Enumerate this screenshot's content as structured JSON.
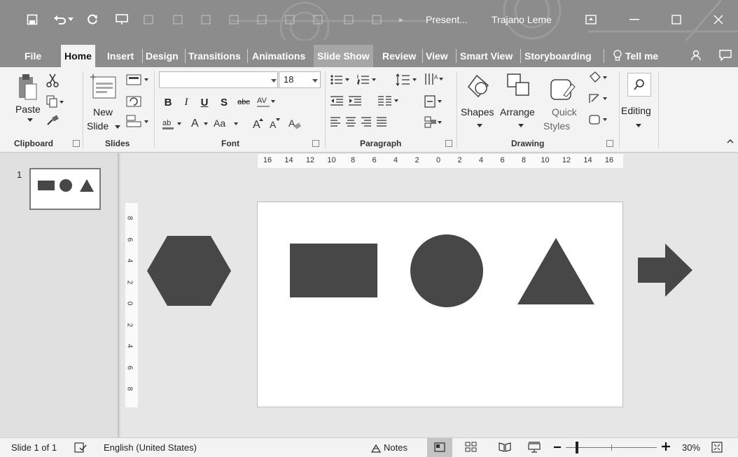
{
  "window": {
    "title": "Present...",
    "user": "Trajano Leme"
  },
  "tabs": [
    {
      "label": "File"
    },
    {
      "label": "Home"
    },
    {
      "label": "Insert"
    },
    {
      "label": "Design"
    },
    {
      "label": "Transitions"
    },
    {
      "label": "Animations"
    },
    {
      "label": "Slide Show"
    },
    {
      "label": "Review"
    },
    {
      "label": "View"
    },
    {
      "label": "Smart View"
    },
    {
      "label": "Storyboarding"
    },
    {
      "label": "Tell me"
    }
  ],
  "ribbon": {
    "clipboard": {
      "label": "Clipboard",
      "paste": "Paste"
    },
    "slides": {
      "label": "Slides",
      "new_slide_1": "New",
      "new_slide_2": "Slide"
    },
    "font": {
      "label": "Font",
      "font_name": "",
      "font_size": "18"
    },
    "paragraph": {
      "label": "Paragraph"
    },
    "drawing": {
      "label": "Drawing",
      "shapes": "Shapes",
      "arrange": "Arrange",
      "quick_1": "Quick",
      "quick_2": "Styles"
    },
    "editing": {
      "label": "Editing"
    }
  },
  "thumbnails": [
    {
      "number": "1"
    }
  ],
  "ruler": {
    "horizontal": [
      "16",
      "14",
      "12",
      "10",
      "8",
      "6",
      "4",
      "2",
      "0",
      "2",
      "4",
      "6",
      "8",
      "10",
      "12",
      "14",
      "16"
    ],
    "vertical": [
      "8",
      "6",
      "4",
      "2",
      "0",
      "2",
      "4",
      "6",
      "8"
    ]
  },
  "status": {
    "slide": "Slide 1 of 1",
    "language": "English (United States)",
    "notes": "Notes",
    "zoom": "30%"
  },
  "colors": {
    "shape_fill": "#474747",
    "titlebar": "#8c8c8c",
    "ribbon": "#f3f3f3"
  }
}
